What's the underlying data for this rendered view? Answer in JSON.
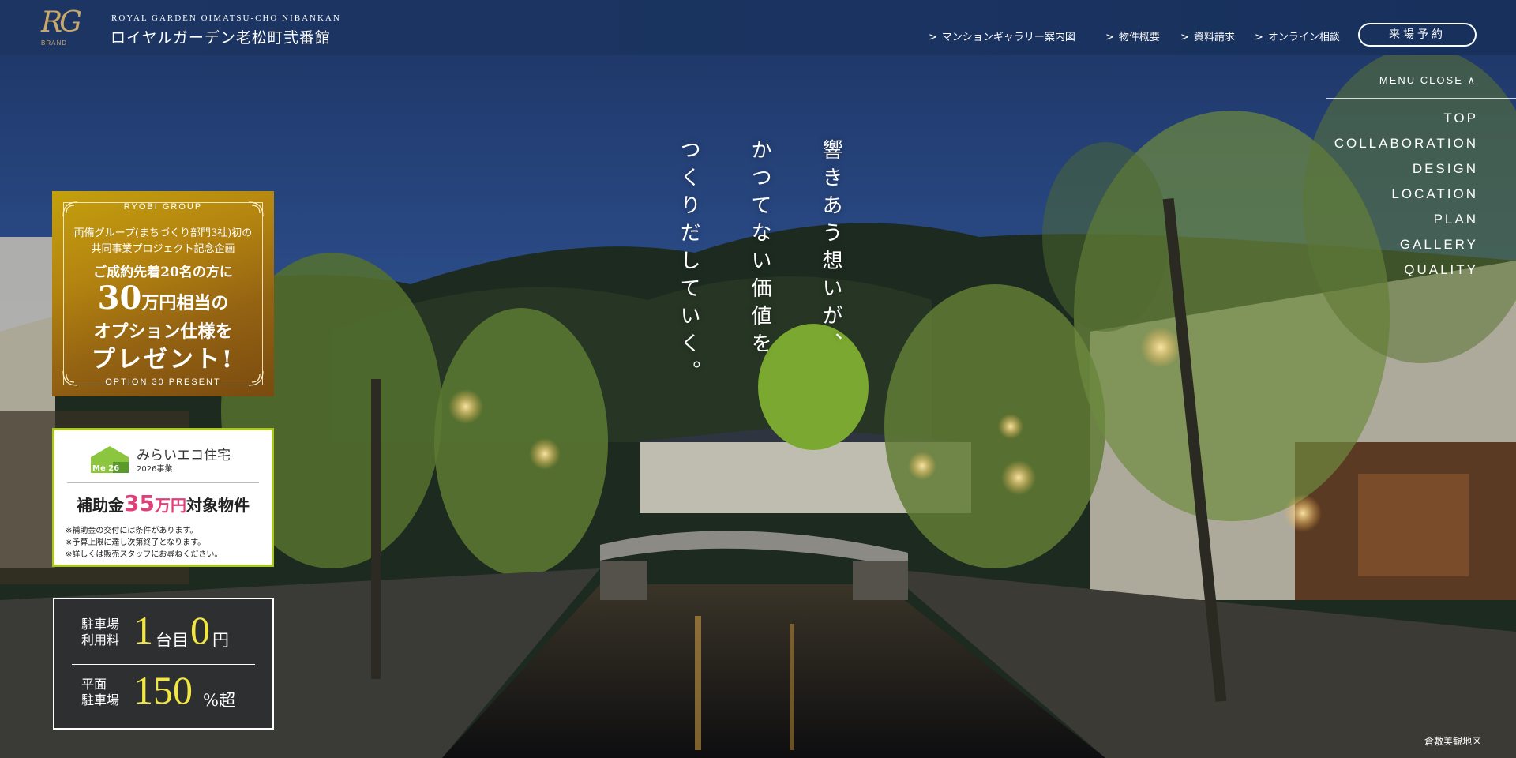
{
  "header": {
    "logo_mark": "RG",
    "logo_brand": "BRAND",
    "logo_en": "ROYAL GARDEN OIMATSU-CHO NIBANKAN",
    "logo_jp": "ロイヤルガーデン老松町弐番館",
    "nav": [
      {
        "label": "マンションギャラリー案内図"
      },
      {
        "label": "物件概要"
      },
      {
        "label": "資料請求"
      },
      {
        "label": "オンライン相談"
      }
    ],
    "reserve_label": "来場予約"
  },
  "menu": {
    "close_label": "MENU CLOSE ∧",
    "items": [
      "TOP",
      "COLLABORATION",
      "DESIGN",
      "LOCATION",
      "PLAN",
      "GALLERY",
      "QUALITY"
    ]
  },
  "hero": {
    "copy_lines": [
      "響きあう想いが、",
      "かつてない価値を",
      "つくりだしていく。"
    ],
    "caption": "倉敷美観地区"
  },
  "campaign": {
    "group": "RYOBI GROUP",
    "line1": "両備グループ(まちづくり部門3社)初の",
    "line2": "共同事業プロジェクト記念企画",
    "line3": "ご成約先着20名の方に",
    "big_number": "30",
    "big_suffix": "万円相当の",
    "line5": "オプション仕様を",
    "line6": "プレゼント!",
    "footer": "OPTION 30 PRESENT"
  },
  "eco": {
    "badge": "Me 26",
    "title": "みらいエコ住宅",
    "subtitle": "2026事業",
    "main_prefix": "補助金",
    "amount": "35",
    "amount_unit": "万円",
    "main_suffix": "対象物件",
    "notes": [
      "※補助金の交付には条件があります。",
      "※予算上限に達し次第終了となります。",
      "※詳しくは販売スタッフにお尋ねください。"
    ]
  },
  "parking": {
    "fee_label": "駐車場\n利用料",
    "fee_count": "1",
    "fee_mid": "台目",
    "fee_value": "0",
    "fee_unit": "円",
    "flat_label": "平面\n駐車場",
    "flat_value": "150",
    "flat_unit": "%超"
  },
  "colors": {
    "header_bg": "#1c3562",
    "gold": "#b48410",
    "eco_border": "#a8c820",
    "eco_pink": "#e0407a",
    "parking_yellow": "#f2e642"
  }
}
